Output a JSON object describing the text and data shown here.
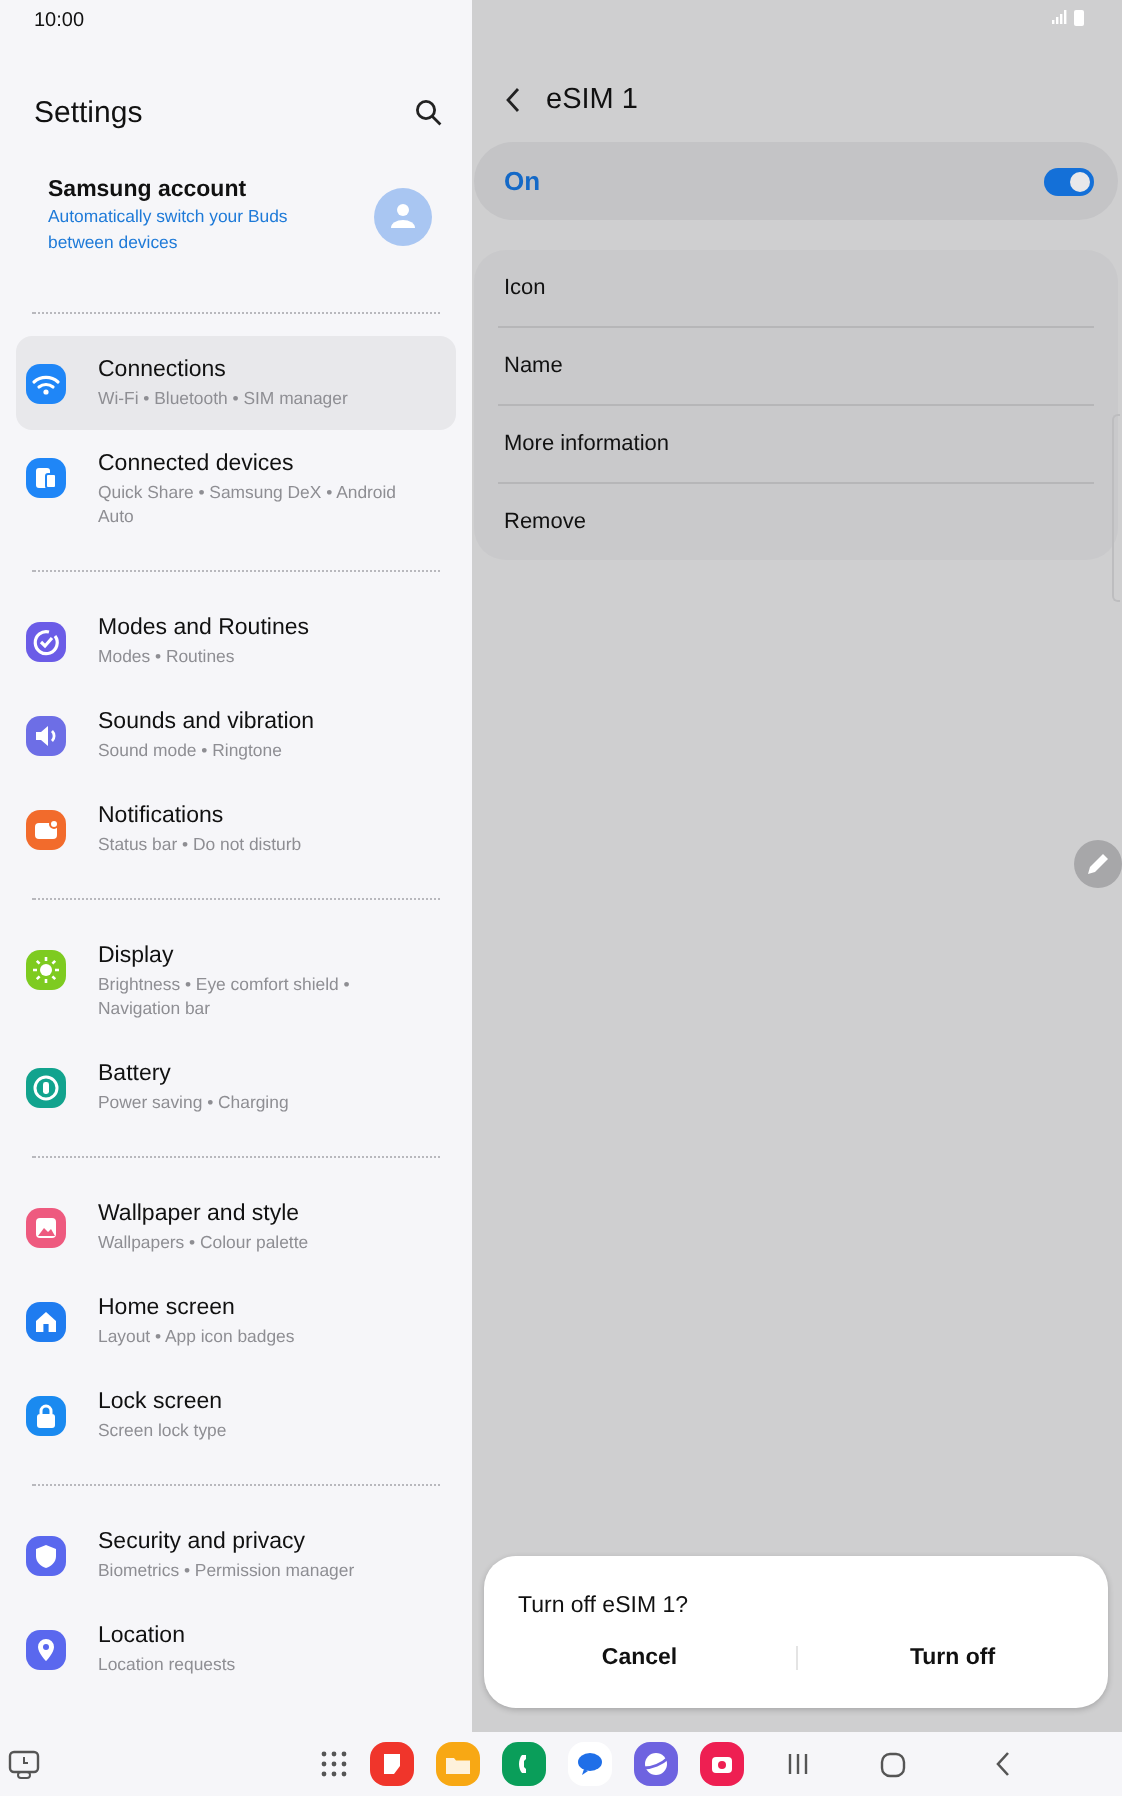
{
  "status_bar": {
    "time": "10:00"
  },
  "settings": {
    "title": "Settings",
    "account": {
      "name": "Samsung account",
      "subtitle": "Automatically switch your Buds between devices"
    },
    "groups": [
      {
        "items": [
          {
            "title": "Connections",
            "subtitle": "Wi-Fi • Bluetooth • SIM manager",
            "color": "#1f86f7",
            "selected": true
          },
          {
            "title": "Connected devices",
            "subtitle": "Quick Share • Samsung DeX • Android Auto",
            "color": "#1f86f7",
            "selected": false
          }
        ]
      },
      {
        "items": [
          {
            "title": "Modes and Routines",
            "subtitle": "Modes • Routines",
            "color": "#6b5ce7",
            "selected": false
          },
          {
            "title": "Sounds and vibration",
            "subtitle": "Sound mode • Ringtone",
            "color": "#6d6ee6",
            "selected": false
          },
          {
            "title": "Notifications",
            "subtitle": "Status bar • Do not disturb",
            "color": "#f26b2c",
            "selected": false
          }
        ]
      },
      {
        "items": [
          {
            "title": "Display",
            "subtitle": "Brightness • Eye comfort shield • Navigation bar",
            "color": "#7ecb20",
            "selected": false
          },
          {
            "title": "Battery",
            "subtitle": "Power saving • Charging",
            "color": "#12a38e",
            "selected": false
          }
        ]
      },
      {
        "items": [
          {
            "title": "Wallpaper and style",
            "subtitle": "Wallpapers • Colour palette",
            "color": "#ee5a7f",
            "selected": false
          },
          {
            "title": "Home screen",
            "subtitle": "Layout • App icon badges",
            "color": "#1f7cf0",
            "selected": false
          },
          {
            "title": "Lock screen",
            "subtitle": "Screen lock type",
            "color": "#1a8af0",
            "selected": false
          }
        ]
      },
      {
        "items": [
          {
            "title": "Security and privacy",
            "subtitle": "Biometrics • Permission manager",
            "color": "#5a68ee",
            "selected": false
          },
          {
            "title": "Location",
            "subtitle": "Location requests",
            "color": "#5a68ee",
            "selected": false
          }
        ]
      }
    ]
  },
  "detail": {
    "title": "eSIM 1",
    "toggle": {
      "label": "On",
      "on": true
    },
    "items": [
      "Icon",
      "Name",
      "More information",
      "Remove"
    ]
  },
  "dialog": {
    "title": "Turn off eSIM 1?",
    "buttons": [
      "Cancel",
      "Turn off"
    ]
  },
  "taskbar": {
    "apps": [
      {
        "color": "#f0352b"
      },
      {
        "color": "#f8a814"
      },
      {
        "color": "#0a9e5a"
      },
      {
        "color": "#ffffff"
      },
      {
        "color": "#6e63e0"
      },
      {
        "color": "#ee1f52"
      }
    ]
  }
}
